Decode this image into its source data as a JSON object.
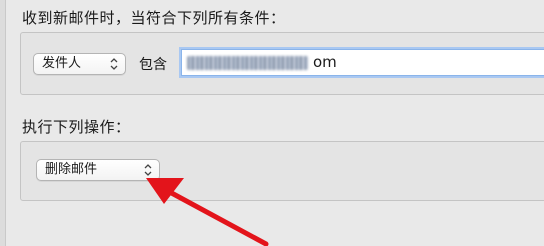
{
  "conditions": {
    "heading": "收到新邮件时，当符合下列所有条件：",
    "field_popup": {
      "value": "发件人",
      "icon": "chevron-updown-icon"
    },
    "operator_label": "包含",
    "value_field": {
      "visible_suffix": "om",
      "obscured": true
    }
  },
  "actions": {
    "heading": "执行下列操作：",
    "action_popup": {
      "value": "删除邮件",
      "icon": "chevron-updown-icon"
    }
  },
  "annotation": {
    "arrow_color": "#e3141b"
  },
  "colors": {
    "background": "#e9e9e9",
    "focus_ring": "#a9c8f2",
    "arrow": "#e3141b"
  }
}
